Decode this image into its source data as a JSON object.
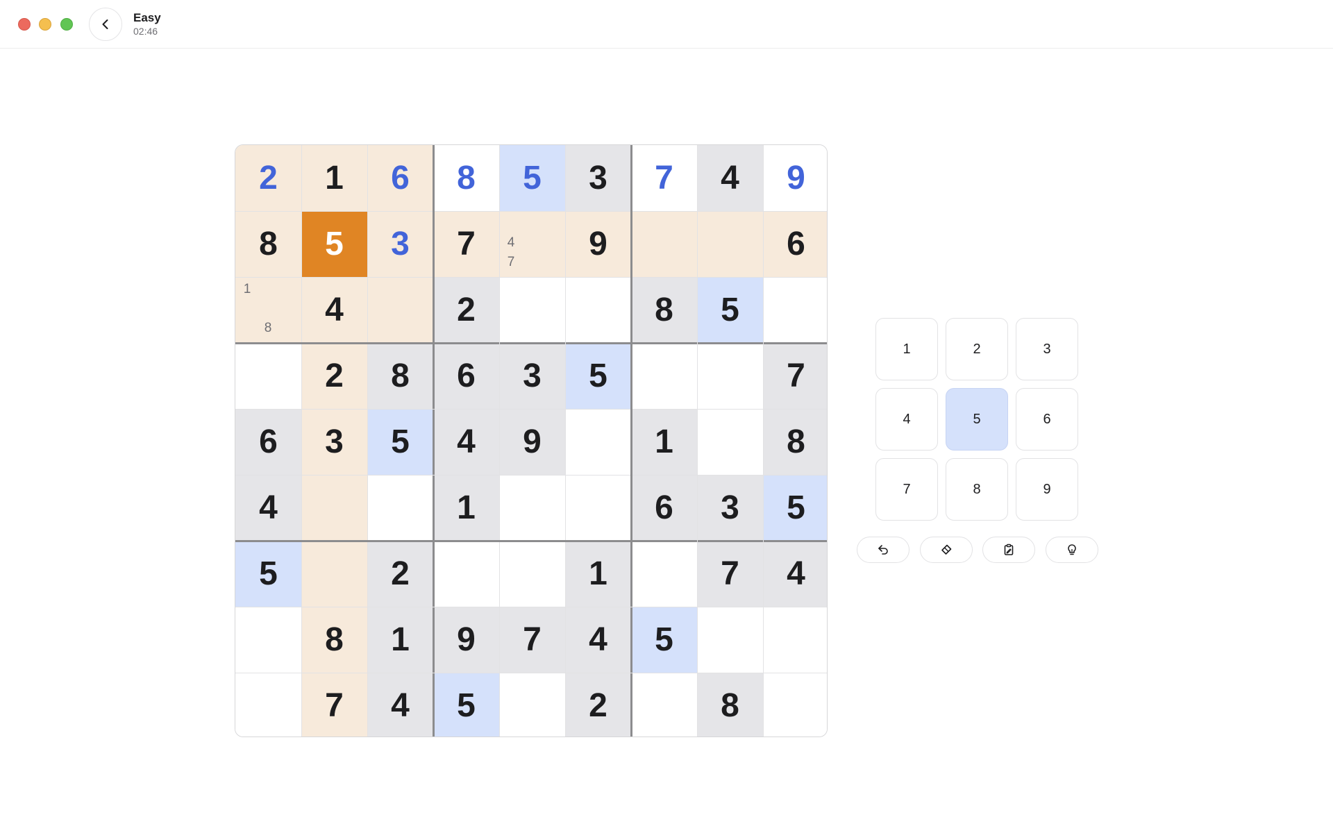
{
  "window": {
    "title": "Easy",
    "timer": "02:46"
  },
  "colors": {
    "selected": "#e08524",
    "peer_highlight": "#f7eadb",
    "same_number": "#d5e1fb",
    "given_fill": "#e5e5e8",
    "empty": "#ffffff",
    "user_digit": "#4264d9"
  },
  "board": {
    "selected_cell": [
      1,
      1
    ],
    "cells": [
      [
        {
          "v": "2",
          "t": "user",
          "bg": "peer"
        },
        {
          "v": "1",
          "t": "given",
          "bg": "peer"
        },
        {
          "v": "6",
          "t": "user",
          "bg": "peer"
        },
        {
          "v": "8",
          "t": "user",
          "bg": "white"
        },
        {
          "v": "5",
          "t": "user",
          "bg": "same"
        },
        {
          "v": "3",
          "t": "given",
          "bg": "grey"
        },
        {
          "v": "7",
          "t": "user",
          "bg": "white"
        },
        {
          "v": "4",
          "t": "given",
          "bg": "grey"
        },
        {
          "v": "9",
          "t": "user",
          "bg": "white"
        }
      ],
      [
        {
          "v": "8",
          "t": "given",
          "bg": "peer"
        },
        {
          "v": "5",
          "t": "selected",
          "bg": "selected"
        },
        {
          "v": "3",
          "t": "user",
          "bg": "peer"
        },
        {
          "v": "7",
          "t": "given",
          "bg": "peer"
        },
        {
          "v": "",
          "t": "notes",
          "bg": "peer",
          "notes": [
            "4",
            "7"
          ]
        },
        {
          "v": "9",
          "t": "given",
          "bg": "peer"
        },
        {
          "v": "",
          "t": "empty",
          "bg": "peer"
        },
        {
          "v": "",
          "t": "empty",
          "bg": "peer"
        },
        {
          "v": "6",
          "t": "given",
          "bg": "peer"
        }
      ],
      [
        {
          "v": "",
          "t": "notes",
          "bg": "peer",
          "notes": [
            "1",
            "8"
          ]
        },
        {
          "v": "4",
          "t": "given",
          "bg": "peer"
        },
        {
          "v": "",
          "t": "empty",
          "bg": "peer"
        },
        {
          "v": "2",
          "t": "given",
          "bg": "grey"
        },
        {
          "v": "",
          "t": "empty",
          "bg": "white"
        },
        {
          "v": "",
          "t": "empty",
          "bg": "white"
        },
        {
          "v": "8",
          "t": "given",
          "bg": "grey"
        },
        {
          "v": "5",
          "t": "given",
          "bg": "same"
        },
        {
          "v": "",
          "t": "empty",
          "bg": "white"
        }
      ],
      [
        {
          "v": "",
          "t": "empty",
          "bg": "white"
        },
        {
          "v": "2",
          "t": "given",
          "bg": "peer"
        },
        {
          "v": "8",
          "t": "given",
          "bg": "grey"
        },
        {
          "v": "6",
          "t": "given",
          "bg": "grey"
        },
        {
          "v": "3",
          "t": "given",
          "bg": "grey"
        },
        {
          "v": "5",
          "t": "given",
          "bg": "same"
        },
        {
          "v": "",
          "t": "empty",
          "bg": "white"
        },
        {
          "v": "",
          "t": "empty",
          "bg": "white"
        },
        {
          "v": "7",
          "t": "given",
          "bg": "grey"
        }
      ],
      [
        {
          "v": "6",
          "t": "given",
          "bg": "grey"
        },
        {
          "v": "3",
          "t": "given",
          "bg": "peer"
        },
        {
          "v": "5",
          "t": "given",
          "bg": "same"
        },
        {
          "v": "4",
          "t": "given",
          "bg": "grey"
        },
        {
          "v": "9",
          "t": "given",
          "bg": "grey"
        },
        {
          "v": "",
          "t": "empty",
          "bg": "white"
        },
        {
          "v": "1",
          "t": "given",
          "bg": "grey"
        },
        {
          "v": "",
          "t": "empty",
          "bg": "white"
        },
        {
          "v": "8",
          "t": "given",
          "bg": "grey"
        }
      ],
      [
        {
          "v": "4",
          "t": "given",
          "bg": "grey"
        },
        {
          "v": "",
          "t": "empty",
          "bg": "peer"
        },
        {
          "v": "",
          "t": "empty",
          "bg": "white"
        },
        {
          "v": "1",
          "t": "given",
          "bg": "grey"
        },
        {
          "v": "",
          "t": "empty",
          "bg": "white"
        },
        {
          "v": "",
          "t": "empty",
          "bg": "white"
        },
        {
          "v": "6",
          "t": "given",
          "bg": "grey"
        },
        {
          "v": "3",
          "t": "given",
          "bg": "grey"
        },
        {
          "v": "5",
          "t": "given",
          "bg": "same"
        }
      ],
      [
        {
          "v": "5",
          "t": "given",
          "bg": "same"
        },
        {
          "v": "",
          "t": "empty",
          "bg": "peer"
        },
        {
          "v": "2",
          "t": "given",
          "bg": "grey"
        },
        {
          "v": "",
          "t": "empty",
          "bg": "white"
        },
        {
          "v": "",
          "t": "empty",
          "bg": "white"
        },
        {
          "v": "1",
          "t": "given",
          "bg": "grey"
        },
        {
          "v": "",
          "t": "empty",
          "bg": "white"
        },
        {
          "v": "7",
          "t": "given",
          "bg": "grey"
        },
        {
          "v": "4",
          "t": "given",
          "bg": "grey"
        }
      ],
      [
        {
          "v": "",
          "t": "empty",
          "bg": "white"
        },
        {
          "v": "8",
          "t": "given",
          "bg": "peer"
        },
        {
          "v": "1",
          "t": "given",
          "bg": "grey"
        },
        {
          "v": "9",
          "t": "given",
          "bg": "grey"
        },
        {
          "v": "7",
          "t": "given",
          "bg": "grey"
        },
        {
          "v": "4",
          "t": "given",
          "bg": "grey"
        },
        {
          "v": "5",
          "t": "given",
          "bg": "same"
        },
        {
          "v": "",
          "t": "empty",
          "bg": "white"
        },
        {
          "v": "",
          "t": "empty",
          "bg": "white"
        }
      ],
      [
        {
          "v": "",
          "t": "empty",
          "bg": "white"
        },
        {
          "v": "7",
          "t": "given",
          "bg": "peer"
        },
        {
          "v": "4",
          "t": "given",
          "bg": "grey"
        },
        {
          "v": "5",
          "t": "given",
          "bg": "same"
        },
        {
          "v": "",
          "t": "empty",
          "bg": "white"
        },
        {
          "v": "2",
          "t": "given",
          "bg": "grey"
        },
        {
          "v": "",
          "t": "empty",
          "bg": "white"
        },
        {
          "v": "8",
          "t": "given",
          "bg": "grey"
        },
        {
          "v": "",
          "t": "empty",
          "bg": "white"
        }
      ]
    ]
  },
  "number_pad": {
    "buttons": [
      "1",
      "2",
      "3",
      "4",
      "5",
      "6",
      "7",
      "8",
      "9"
    ],
    "active": "5"
  },
  "tools": [
    {
      "name": "undo",
      "icon": "undo-icon"
    },
    {
      "name": "erase",
      "icon": "eraser-icon"
    },
    {
      "name": "notes",
      "icon": "pencil-clipboard-icon"
    },
    {
      "name": "hint",
      "icon": "lightbulb-icon"
    }
  ]
}
